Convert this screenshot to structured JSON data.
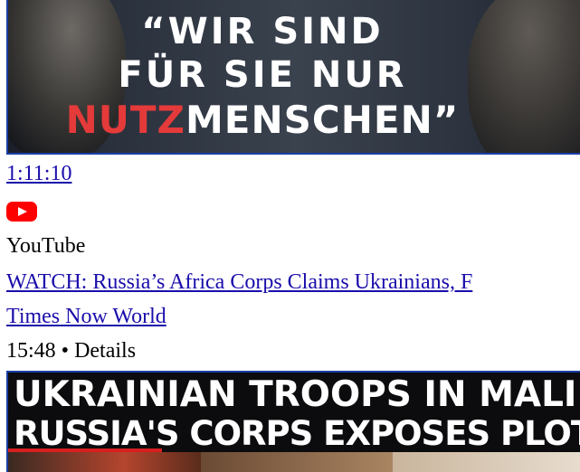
{
  "video1": {
    "thumbnail_text": {
      "line1": "“WIR SIND",
      "line2": "FÜR SIE NUR",
      "line3_red": "NUTZ",
      "line3_rest": "MENSCHEN”"
    },
    "duration": "1:11:10",
    "source_icon": "youtube-icon",
    "source": "YouTube"
  },
  "video2": {
    "title": "WATCH: Russia’s Africa Corps Claims Ukrainians, F",
    "channel": "Times Now World",
    "meta": "15:48 • Details",
    "thumbnail_text": {
      "line1": "UKRAINIAN TROOPS IN MALI",
      "line2": "RUSSIA'S CORPS EXPOSES PLOT"
    }
  },
  "colors": {
    "link": "#1a0dab",
    "youtube_red": "#ff0000",
    "thumbnail_accent_red": "#e53a3a"
  }
}
